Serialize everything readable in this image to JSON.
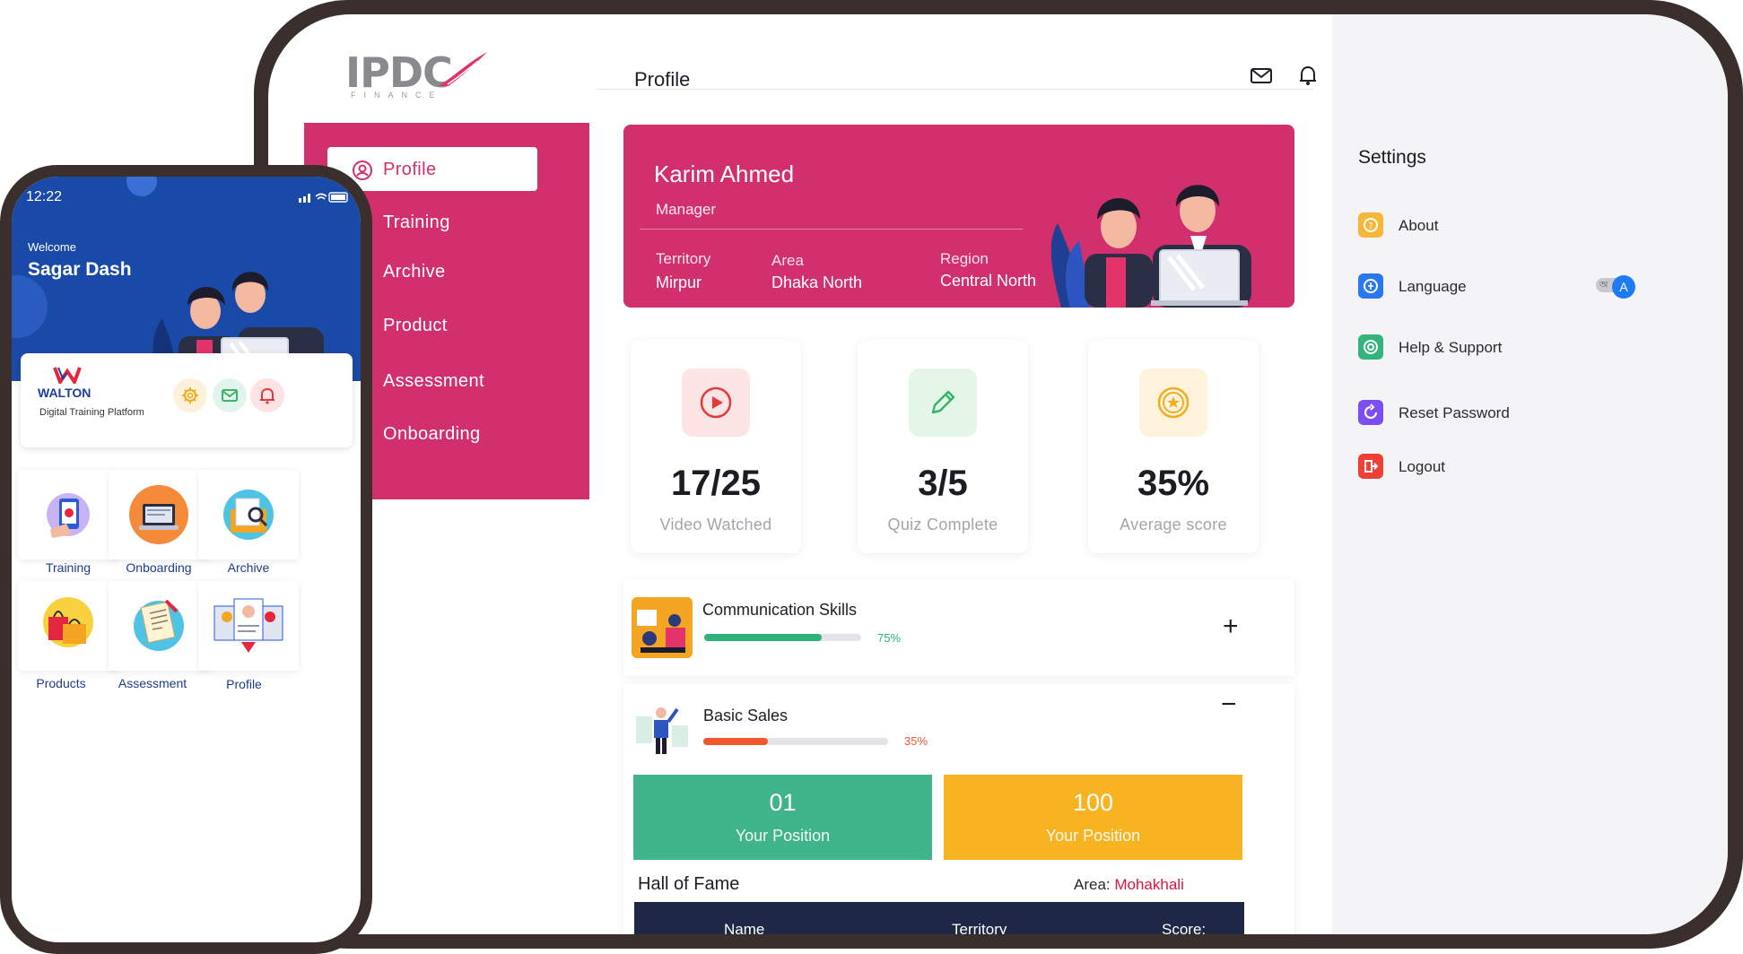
{
  "tablet": {
    "logo": {
      "text": "IPDC",
      "sub": "FINANCE"
    },
    "header": {
      "title": "Profile",
      "icons": [
        "mail-icon",
        "bell-icon"
      ]
    },
    "side_menu": {
      "items": [
        {
          "label": "Profile",
          "active": true
        },
        {
          "label": "Training"
        },
        {
          "label": "Archive"
        },
        {
          "label": "Product"
        },
        {
          "label": "Assessment"
        },
        {
          "label": "Onboarding"
        }
      ]
    },
    "profile": {
      "name": "Karim Ahmed",
      "role": "Manager",
      "territory_label": "Territory",
      "territory": "Mirpur",
      "area_label": "Area",
      "area": "Dhaka North",
      "region_label": "Region",
      "region": "Central North"
    },
    "stats": [
      {
        "value": "17/25",
        "label": "Video Watched",
        "icon": "play-icon",
        "color": "#e23b3b"
      },
      {
        "value": "3/5",
        "label": "Quiz Complete",
        "icon": "pencil-icon",
        "color": "#3bb36c"
      },
      {
        "value": "35%",
        "label": "Average score",
        "icon": "star-badge-icon",
        "color": "#f0ad1d"
      }
    ],
    "courses": [
      {
        "title": "Communication Skills",
        "progress": 0.75,
        "pct_label": "75%",
        "color": "#2db37a",
        "action": "+"
      },
      {
        "title": "Basic Sales",
        "progress": 0.35,
        "pct_label": "35%",
        "color": "#f1582e",
        "action": "−"
      }
    ],
    "positions": [
      {
        "value": "01",
        "label": "Your Position",
        "color": "#40b48a"
      },
      {
        "value": "100",
        "label": "Your Position",
        "color": "#f8b322"
      }
    ],
    "hall_of_fame": {
      "title": "Hall of Fame",
      "area_label": "Area: ",
      "area_value": "Mohakhali",
      "columns": [
        "Name",
        "Territory",
        "Score:"
      ]
    },
    "settings": {
      "title": "Settings",
      "items": [
        {
          "label": "About",
          "icon": "info-icon",
          "color": "#f5b63a"
        },
        {
          "label": "Language",
          "icon": "language-icon",
          "color": "#2a78f0"
        },
        {
          "label": "Help & Support",
          "icon": "support-icon",
          "color": "#34b37c"
        },
        {
          "label": "Reset Password",
          "icon": "reset-icon",
          "color": "#7c4df0"
        },
        {
          "label": "Logout",
          "icon": "logout-icon",
          "color": "#ee4035"
        }
      ],
      "language_toggle": {
        "off_glyph": "অ",
        "on_glyph": "A"
      }
    }
  },
  "phone": {
    "time": "12:22",
    "welcome": "Welcome",
    "user": "Sagar Dash",
    "brand": {
      "name": "WALTON",
      "sub": "Digital Training Platform"
    },
    "tiles": [
      {
        "label": "Training"
      },
      {
        "label": "Onboarding"
      },
      {
        "label": "Archive"
      },
      {
        "label": "Products"
      },
      {
        "label": "Assessment"
      },
      {
        "label": "Profile"
      }
    ]
  }
}
